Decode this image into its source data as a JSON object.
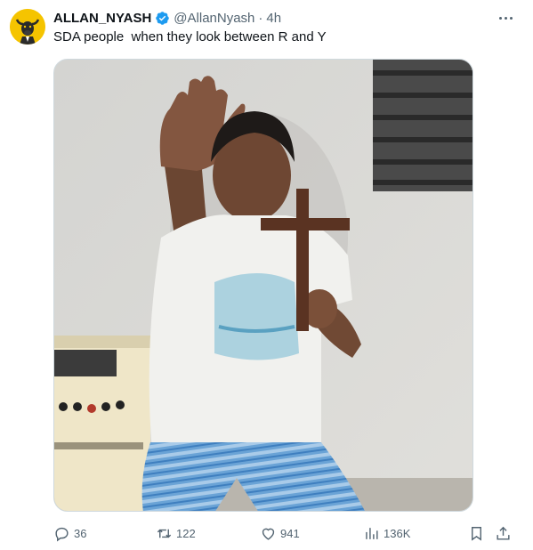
{
  "author": {
    "name": "ALLAN_NYASH",
    "handle": "@AllanNyash",
    "separator": "·",
    "time": "4h"
  },
  "tweet": {
    "text": "SDA people  when they look between R and Y"
  },
  "icons": {
    "avatar": "bull-avatar",
    "verified": "verified-badge-icon",
    "more": "more-icon",
    "reply": "reply-icon",
    "retweet": "retweet-icon",
    "like": "heart-icon",
    "views": "views-chart-icon",
    "bookmark": "bookmark-icon",
    "share": "share-icon"
  },
  "stats": {
    "replies": "36",
    "retweets": "122",
    "likes": "941",
    "views": "136K"
  },
  "colors": {
    "verified": "#1d9bf0",
    "muted": "#536471",
    "text": "#0f1419",
    "avatar_bg": "#f5c400"
  }
}
